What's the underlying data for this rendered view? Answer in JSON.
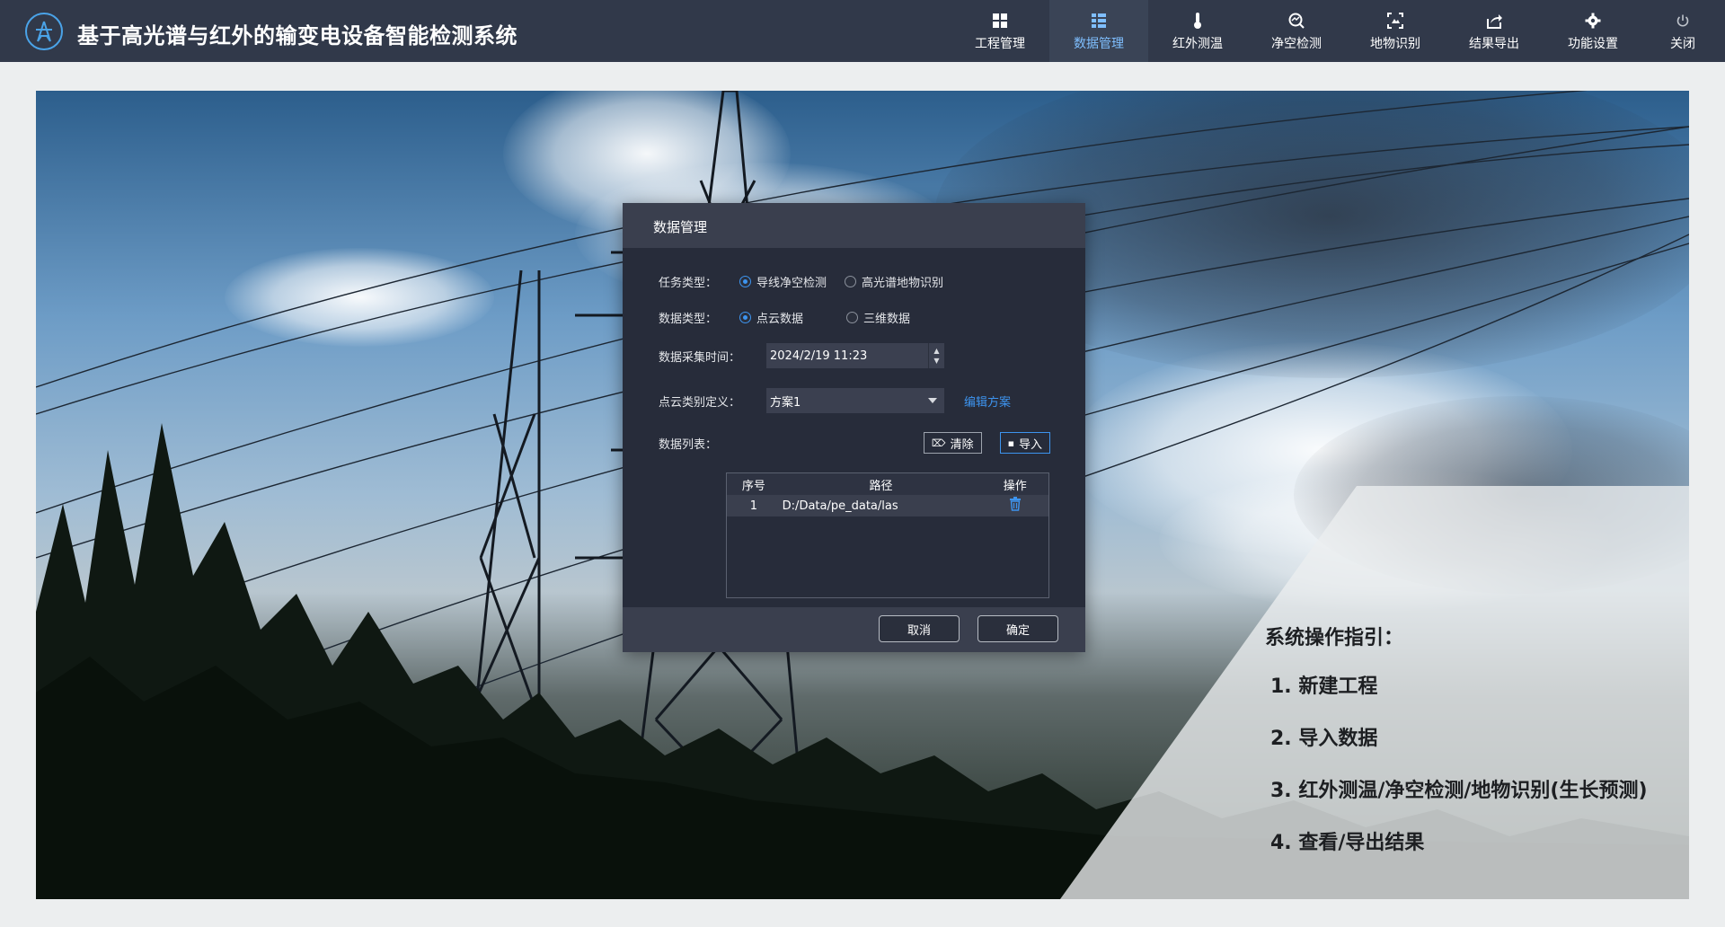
{
  "app": {
    "title": "基于高光谱与红外的输变电设备智能检测系统",
    "accent": "#3d94ef"
  },
  "nav": {
    "items": [
      {
        "label": "工程管理",
        "icon": "grid-icon"
      },
      {
        "label": "数据管理",
        "icon": "database-list-icon",
        "active": true
      },
      {
        "label": "红外测温",
        "icon": "thermometer-icon"
      },
      {
        "label": "净空检测",
        "icon": "search-scan-icon"
      },
      {
        "label": "地物识别",
        "icon": "recognize-icon"
      },
      {
        "label": "结果导出",
        "icon": "export-icon"
      },
      {
        "label": "功能设置",
        "icon": "gear-icon"
      },
      {
        "label": "关闭",
        "icon": "power-icon"
      }
    ]
  },
  "guide": {
    "title": "系统操作指引：",
    "steps": [
      "1.  新建工程",
      "2.  导入数据",
      "3.  红外测温/净空检测/地物识别(生长预测)",
      "4.  查看/导出结果"
    ]
  },
  "dialog": {
    "title": "数据管理",
    "task_type": {
      "label": "任务类型：",
      "options": [
        "导线净空检测",
        "高光谱地物识别"
      ],
      "selected": "导线净空检测"
    },
    "data_type": {
      "label": "数据类型：",
      "options": [
        "点云数据",
        "三维数据"
      ],
      "selected": "点云数据"
    },
    "collect_time": {
      "label": "数据采集时间：",
      "value": "2024/2/19 11:23"
    },
    "pc_category": {
      "label": "点云类别定义：",
      "value": "方案1",
      "edit_link": "编辑方案"
    },
    "data_list": {
      "label": "数据列表：",
      "clear_label": "清除",
      "import_label": "导入",
      "columns": [
        "序号",
        "路径",
        "操作"
      ],
      "rows": [
        {
          "index": "1",
          "path": "D:/Data/pe_data/las",
          "action": "delete-icon"
        }
      ]
    },
    "cancel_label": "取消",
    "ok_label": "确定"
  }
}
